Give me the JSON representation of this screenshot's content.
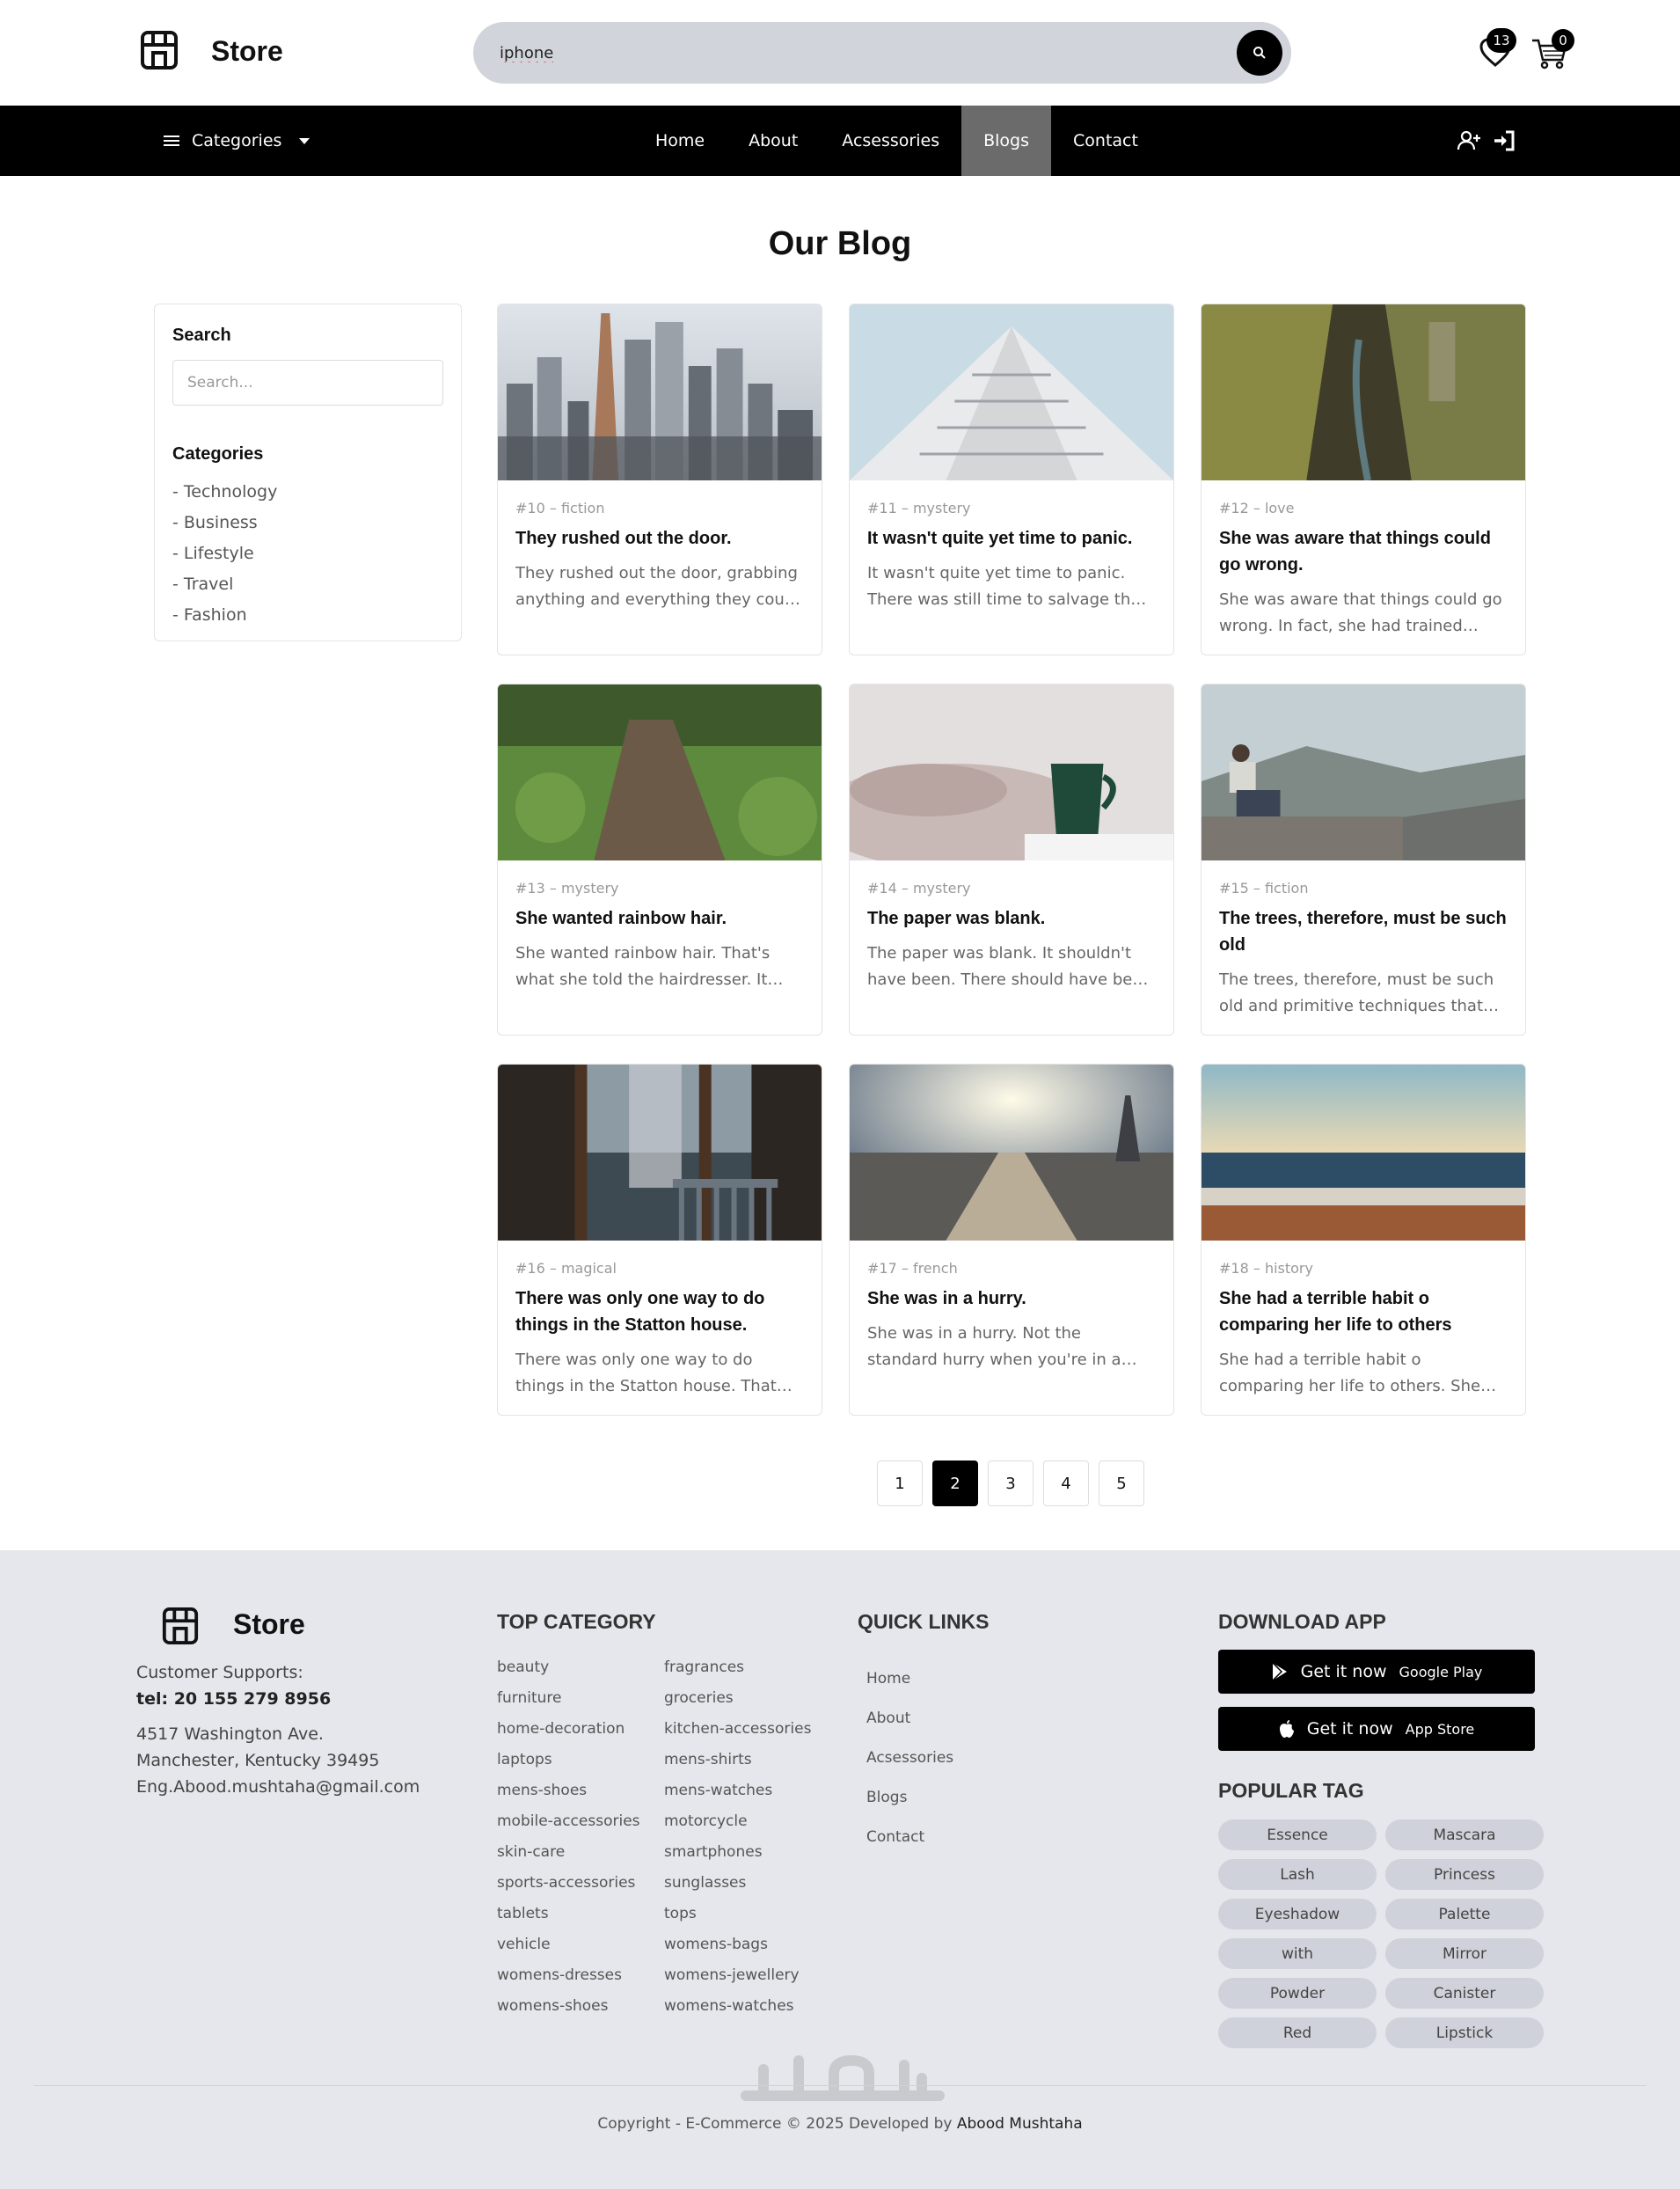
{
  "header": {
    "brand": "Store",
    "search_value": "iphone",
    "wishlist_count": "13",
    "cart_count": "0"
  },
  "nav": {
    "categories_label": "Categories",
    "links": [
      {
        "label": "Home",
        "active": false
      },
      {
        "label": "About",
        "active": false
      },
      {
        "label": "Acsessories",
        "active": false
      },
      {
        "label": "Blogs",
        "active": true
      },
      {
        "label": "Contact",
        "active": false
      }
    ]
  },
  "main": {
    "title": "Our Blog"
  },
  "sidebar": {
    "search_heading": "Search",
    "search_placeholder": "Search...",
    "categories_heading": "Categories",
    "categories": [
      "- Technology",
      "- Business",
      "- Lifestyle",
      "- Travel",
      "- Fashion"
    ]
  },
  "posts": [
    {
      "meta": "#10 – fiction",
      "title": "They rushed out the door.",
      "excerpt": "They rushed out the door, grabbing anything and everything they could grab.",
      "image": "city-skyline"
    },
    {
      "meta": "#11 – mystery",
      "title": "It wasn't quite yet time to panic.",
      "excerpt": "It wasn't quite yet time to panic. There was still time to salvage the situation.",
      "image": "white-building"
    },
    {
      "meta": "#12 – love",
      "title": "She was aware that things could go wrong.",
      "excerpt": "She was aware that things could go wrong. In fact, she had trained herself to plan for it.",
      "image": "mossy-canyon"
    },
    {
      "meta": "#13 – mystery",
      "title": "She wanted rainbow hair.",
      "excerpt": "She wanted rainbow hair. That's what she told the hairdresser. It should be deep blue.",
      "image": "grass-path"
    },
    {
      "meta": "#14 – mystery",
      "title": "The paper was blank.",
      "excerpt": "The paper was blank. It shouldn't have been. There should have been writing on it.",
      "image": "coffee-mug"
    },
    {
      "meta": "#15 – fiction",
      "title": "The trees, therefore, must be such old",
      "excerpt": "The trees, therefore, must be such old and primitive techniques that they thought nothing of them.",
      "image": "man-on-wall"
    },
    {
      "meta": "#16 – magical",
      "title": "There was only one way to do things in the Statton house.",
      "excerpt": "There was only one way to do things in the Statton house. That one way was to do exactly what the father said.",
      "image": "window-chair"
    },
    {
      "meta": "#17 – french",
      "title": "She was in a hurry.",
      "excerpt": "She was in a hurry. Not the standard hurry when you're in a rush to get someplace.",
      "image": "paris-eiffel"
    },
    {
      "meta": "#18 – history",
      "title": "She had a terrible habit o comparing her life to others",
      "excerpt": "She had a terrible habit o comparing her life to others. She realized that their life experiences were completely different.",
      "image": "seashore"
    }
  ],
  "pagination": {
    "pages": [
      "1",
      "2",
      "3",
      "4",
      "5"
    ],
    "current": "2"
  },
  "footer": {
    "brand": "Store",
    "support_label": "Customer Supports:",
    "tel": "tel: 20 155 279 8956",
    "address_line1": "4517 Washington Ave.",
    "address_line2": "Manchester, Kentucky 39495",
    "email": "Eng.Abood.mushtaha@gmail.com",
    "top_category_heading": "TOP CATEGORY",
    "top_categories": [
      "beauty",
      "fragrances",
      "furniture",
      "groceries",
      "home-decoration",
      "kitchen-accessories",
      "laptops",
      "mens-shirts",
      "mens-shoes",
      "mens-watches",
      "mobile-accessories",
      "motorcycle",
      "skin-care",
      "smartphones",
      "sports-accessories",
      "sunglasses",
      "tablets",
      "tops",
      "vehicle",
      "womens-bags",
      "womens-dresses",
      "womens-jewellery",
      "womens-shoes",
      "womens-watches"
    ],
    "quick_links_heading": "QUICK LINKS",
    "quick_links": [
      "Home",
      "About",
      "Acsessories",
      "Blogs",
      "Contact"
    ],
    "download_heading": "DOWNLOAD APP",
    "google_play": {
      "label": "Get it now",
      "store": "Google Play"
    },
    "app_store": {
      "label": "Get it now",
      "store": "App Store"
    },
    "popular_tag_heading": "POPULAR TAG",
    "tags": [
      "Essence",
      "Mascara",
      "Lash",
      "Princess",
      "Eyeshadow",
      "Palette",
      "with",
      "Mirror",
      "Powder",
      "Canister",
      "Red",
      "Lipstick"
    ],
    "copyright_prefix": "Copyright - E-Commerce © 2025 Developed by",
    "copyright_author": "Abood Mushtaha"
  },
  "colors": {
    "accent": "#000000",
    "active_nav": "#6b6b6b",
    "footer_bg": "#e5e7ec",
    "tag_bg": "#cfd2da"
  }
}
